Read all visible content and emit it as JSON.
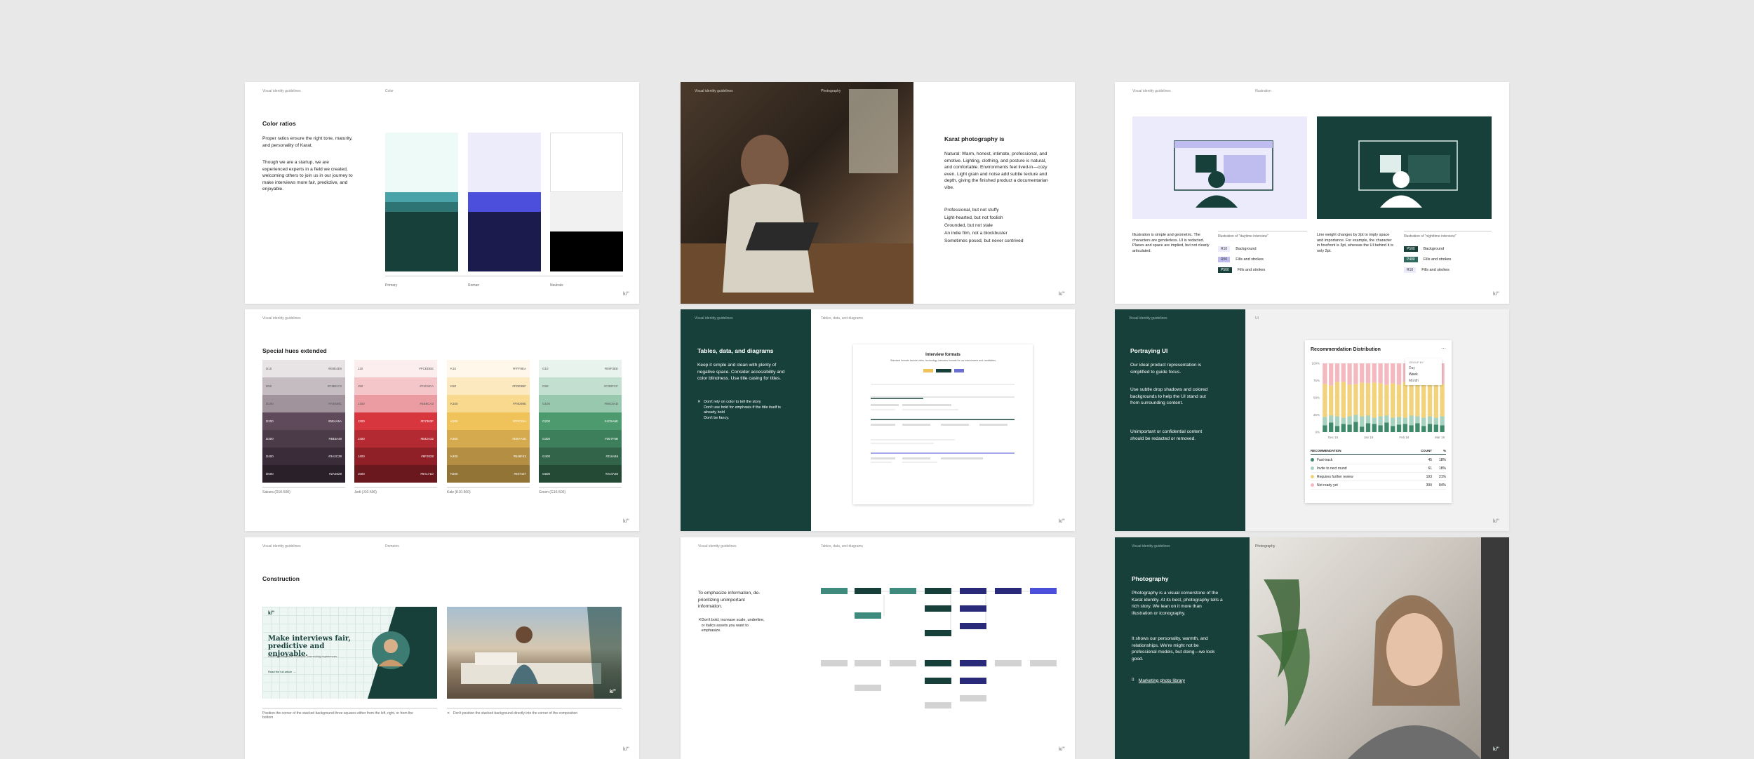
{
  "common": {
    "guide_label": "Visual identity guidelines",
    "brand_mark": "k/ʺ"
  },
  "colors": {
    "teal_dark": "#17403a",
    "teal": "#4aa3a8",
    "indigo": "#4b4fdb",
    "navy": "#1b1c4d"
  },
  "s1": {
    "section": "Color",
    "title": "Color ratios",
    "p1": "Proper ratios ensure the right tone, maturity, and personality of Karat.",
    "p2": "Though we are a startup, we are experienced experts in a field we created, welcoming others to join us in our journey to make interviews more fair, predictive, and enjoyable.",
    "cap_primary": "Primary",
    "cap_roman": "Roman",
    "cap_neutrals": "Neutrals"
  },
  "s2": {
    "section": "Photography",
    "title": "Karat photography is",
    "p1": "Natural: Warm, honest, intimate, professional, and emotive. Lighting, clothing, and posture is natural, and comfortable. Environments feel lived-in—cozy even. Light grain and noise add subtle texture and depth, giving the finished product a documentarian vibe.",
    "l1": "Professional, but not stuffy",
    "l2": "Light-hearted, but not foolish",
    "l3": "Grounded, but not stale",
    "l4": "An indie film, not a blockbuster",
    "l5": "Sometimes posed, but never contrived"
  },
  "s3": {
    "section": "Illustration",
    "cap_left": "Illustration of “daytime interview”",
    "cap_right": "Illustration of “nighttime interview”",
    "text_left": "Illustration is simple and geometric. The characters are genderless. UI is redacted. Planes and space are implied, but not clearly articulated.",
    "text_right": "Line weight changes by 2pt to imply space and importance. For example, the character in forefront is 3pt, whereas the UI behind it is only 2pt.",
    "left_legend": [
      {
        "chip": "R10",
        "label": "Background"
      },
      {
        "chip": "R50",
        "label": "Fills and strokes"
      },
      {
        "chip": "P500",
        "label": "Fills and strokes"
      }
    ],
    "right_legend": [
      {
        "chip": "P500",
        "label": "Background"
      },
      {
        "chip": "P400",
        "label": "Fills and strokes"
      },
      {
        "chip": "R10",
        "label": "Fills and strokes"
      }
    ]
  },
  "s4": {
    "title": "Special hues extended",
    "palettes": [
      {
        "caption": "Sakura (D10-500)",
        "rows": [
          {
            "code": "D10",
            "hex": "#E8E4E6",
            "color": "#e8e4e6"
          },
          {
            "code": "D50",
            "hex": "#C5BCC2",
            "color": "#c5bcc2"
          },
          {
            "code": "D100",
            "hex": "#A0939C",
            "color": "#a0939c"
          },
          {
            "code": "D200",
            "hex": "#5E4A5A",
            "color": "#5e4a5a"
          },
          {
            "code": "D300",
            "hex": "#4B3A48",
            "color": "#4b3a48"
          },
          {
            "code": "D400",
            "hex": "#3A2C38",
            "color": "#3a2c38"
          },
          {
            "code": "D500",
            "hex": "#2A2029",
            "color": "#2a2029"
          }
        ]
      },
      {
        "caption": "Jedi (J10-500)",
        "rows": [
          {
            "code": "J10",
            "hex": "#FCEDEE",
            "color": "#fcedee"
          },
          {
            "code": "J50",
            "hex": "#F4C6CA",
            "color": "#f4c6ca"
          },
          {
            "code": "J100",
            "hex": "#EB9CA3",
            "color": "#eb9ca3"
          },
          {
            "code": "J200",
            "hex": "#D7363F",
            "color": "#d7363f"
          },
          {
            "code": "J300",
            "hex": "#B42A32",
            "color": "#b42a32"
          },
          {
            "code": "J400",
            "hex": "#8F2028",
            "color": "#8f2028"
          },
          {
            "code": "J500",
            "hex": "#6A171D",
            "color": "#6a171d"
          }
        ]
      },
      {
        "caption": "Kale (K10-500)",
        "rows": [
          {
            "code": "K10",
            "hex": "#FFF8EA",
            "color": "#fff8ea"
          },
          {
            "code": "K50",
            "hex": "#FDE9BF",
            "color": "#fde9bf"
          },
          {
            "code": "K100",
            "hex": "#F9D98E",
            "color": "#f9d98e"
          },
          {
            "code": "K200",
            "hex": "#F0C25A",
            "color": "#f0c25a"
          },
          {
            "code": "K300",
            "hex": "#D5AA4E",
            "color": "#d5aa4e"
          },
          {
            "code": "K400",
            "hex": "#B48F43",
            "color": "#b48f43"
          },
          {
            "code": "K500",
            "hex": "#937437",
            "color": "#937437"
          }
        ]
      },
      {
        "caption": "Green (G10-500)",
        "rows": [
          {
            "code": "G10",
            "hex": "#E9F3EE",
            "color": "#e9f3ee"
          },
          {
            "code": "G50",
            "hex": "#C3DFCF",
            "color": "#c3dfcf"
          },
          {
            "code": "G100",
            "hex": "#98C8AD",
            "color": "#98c8ad"
          },
          {
            "code": "G200",
            "hex": "#4C9A6E",
            "color": "#4c9a6e"
          },
          {
            "code": "G300",
            "hex": "#3E7F5B",
            "color": "#3e7f5b"
          },
          {
            "code": "G400",
            "hex": "#316448",
            "color": "#316448"
          },
          {
            "code": "G500",
            "hex": "#244A35",
            "color": "#244a35"
          }
        ]
      }
    ]
  },
  "s5": {
    "section": "Tables, data, and diagrams",
    "title": "Tables, data, and diagrams",
    "p1": "Keep it simple and clean with plenty of negative space. Consider accessibility and color blindness. Use title casing for titles.",
    "dont1": "Don't rely on color to tell the story",
    "dont2": "Don't use bold for emphasis if the title itself is already bold",
    "dont3": "Don't be fancy.",
    "card_title": "Interview formats",
    "card_sub": "Standard formats include video, technology interview formats for our interviewers and candidates"
  },
  "s6": {
    "section": "UI",
    "title": "Portraying UI",
    "p1": "Our ideal product representation is simplified to guide focus.",
    "p2": "Use subtle drop shadows and colored backgrounds to help the UI stand out from surrounding content.",
    "p3": "Unimportant or confidential content should be redacted or removed.",
    "card_title": "Recommendation Distribution",
    "group_by": "GROUP BY",
    "opt_day": "Day",
    "opt_week": "Week",
    "opt_month": "Month",
    "th_rec": "RECOMMENDATION",
    "th_count": "COUNT",
    "th_pct": "%",
    "rows": [
      {
        "label": "Fast-track",
        "count": "45",
        "pct": "18%",
        "color": "#3f8a6a"
      },
      {
        "label": "Invite to next round",
        "count": "61",
        "pct": "18%",
        "color": "#a6d2bf"
      },
      {
        "label": "Requires further review",
        "count": "193",
        "pct": "21%",
        "color": "#f2d27a"
      },
      {
        "label": "Not ready yet",
        "count": "390",
        "pct": "84%",
        "color": "#f4b9c0"
      }
    ]
  },
  "chart_data": {
    "type": "bar",
    "title": "Recommendation Distribution",
    "xlabel": "",
    "ylabel": "",
    "ylim": [
      0,
      100
    ],
    "yticks": [
      "100%",
      "75%",
      "50%",
      "25%",
      "0%"
    ],
    "xticks": [
      "Dec 18",
      "Jan 18",
      "Feb 18",
      "Mar 18"
    ],
    "categories": [
      "1",
      "2",
      "3",
      "4",
      "5",
      "6",
      "7",
      "8",
      "9",
      "10",
      "11",
      "12",
      "13",
      "14",
      "15",
      "16",
      "17",
      "18",
      "19",
      "20"
    ],
    "series": [
      {
        "name": "Fast-track",
        "color": "#3f8a6a",
        "values": [
          10,
          14,
          9,
          12,
          11,
          15,
          8,
          13,
          12,
          10,
          14,
          9,
          11,
          12,
          10,
          13,
          9,
          12,
          11,
          10
        ]
      },
      {
        "name": "Invite to next round",
        "color": "#a6d2bf",
        "values": [
          12,
          10,
          14,
          9,
          12,
          10,
          15,
          11,
          9,
          13,
          10,
          12,
          11,
          9,
          14,
          10,
          12,
          11,
          10,
          13
        ]
      },
      {
        "name": "Requires further review",
        "color": "#f2d27a",
        "values": [
          48,
          44,
          50,
          52,
          46,
          45,
          49,
          47,
          51,
          48,
          45,
          50,
          47,
          52,
          46,
          49,
          48,
          46,
          50,
          47
        ]
      },
      {
        "name": "Not ready yet",
        "color": "#f4b9c0",
        "values": [
          30,
          32,
          27,
          27,
          31,
          30,
          28,
          29,
          28,
          29,
          31,
          29,
          31,
          27,
          30,
          28,
          31,
          31,
          29,
          30
        ]
      }
    ]
  },
  "s7": {
    "section": "Domains",
    "title": "Construction",
    "hero_title": "Make interviews fair, predictive and enjoyable.",
    "hero_sub": "Karat's global leader in people, connecting experiences...",
    "hero_link": "Read the full article →",
    "cap_left": "Position the corner of the stacked background three squares either from the left, right, or from the bottom",
    "cap_right": "Don't position the stacked background directly into the corner of the composition"
  },
  "s8": {
    "section": "Tables, data, and diagrams",
    "p1": "To emphasize information, de-prioritizing unimportant information.",
    "dont1": "Don't bold, increase scale, underline, or italics assets you want to emphasize."
  },
  "s9": {
    "section": "Photography",
    "title": "Photography",
    "p1": "Photography is a visual cornerstone of the Karat identity. At its best, photography tells a rich story. We lean on it more than illustration or iconography.",
    "p2": "It shows our personality, warmth, and relationships. We're might not be professional models, but doing—we look good.",
    "link": "Marketing photo library"
  }
}
